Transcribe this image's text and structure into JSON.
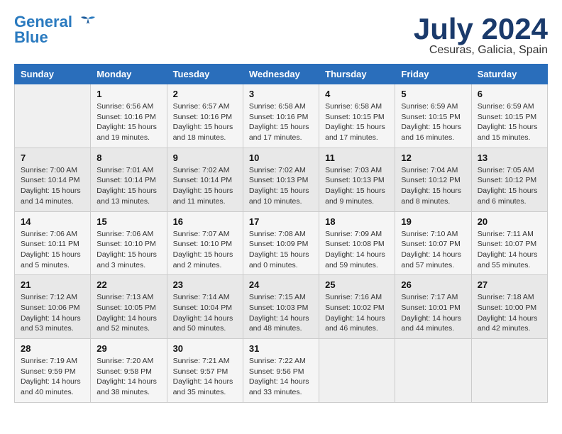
{
  "header": {
    "logo_line1": "General",
    "logo_line2": "Blue",
    "month": "July 2024",
    "location": "Cesuras, Galicia, Spain"
  },
  "weekdays": [
    "Sunday",
    "Monday",
    "Tuesday",
    "Wednesday",
    "Thursday",
    "Friday",
    "Saturday"
  ],
  "weeks": [
    [
      {
        "day": "",
        "sunrise": "",
        "sunset": "",
        "daylight": ""
      },
      {
        "day": "1",
        "sunrise": "Sunrise: 6:56 AM",
        "sunset": "Sunset: 10:16 PM",
        "daylight": "Daylight: 15 hours and 19 minutes."
      },
      {
        "day": "2",
        "sunrise": "Sunrise: 6:57 AM",
        "sunset": "Sunset: 10:16 PM",
        "daylight": "Daylight: 15 hours and 18 minutes."
      },
      {
        "day": "3",
        "sunrise": "Sunrise: 6:58 AM",
        "sunset": "Sunset: 10:16 PM",
        "daylight": "Daylight: 15 hours and 17 minutes."
      },
      {
        "day": "4",
        "sunrise": "Sunrise: 6:58 AM",
        "sunset": "Sunset: 10:15 PM",
        "daylight": "Daylight: 15 hours and 17 minutes."
      },
      {
        "day": "5",
        "sunrise": "Sunrise: 6:59 AM",
        "sunset": "Sunset: 10:15 PM",
        "daylight": "Daylight: 15 hours and 16 minutes."
      },
      {
        "day": "6",
        "sunrise": "Sunrise: 6:59 AM",
        "sunset": "Sunset: 10:15 PM",
        "daylight": "Daylight: 15 hours and 15 minutes."
      }
    ],
    [
      {
        "day": "7",
        "sunrise": "Sunrise: 7:00 AM",
        "sunset": "Sunset: 10:14 PM",
        "daylight": "Daylight: 15 hours and 14 minutes."
      },
      {
        "day": "8",
        "sunrise": "Sunrise: 7:01 AM",
        "sunset": "Sunset: 10:14 PM",
        "daylight": "Daylight: 15 hours and 13 minutes."
      },
      {
        "day": "9",
        "sunrise": "Sunrise: 7:02 AM",
        "sunset": "Sunset: 10:14 PM",
        "daylight": "Daylight: 15 hours and 11 minutes."
      },
      {
        "day": "10",
        "sunrise": "Sunrise: 7:02 AM",
        "sunset": "Sunset: 10:13 PM",
        "daylight": "Daylight: 15 hours and 10 minutes."
      },
      {
        "day": "11",
        "sunrise": "Sunrise: 7:03 AM",
        "sunset": "Sunset: 10:13 PM",
        "daylight": "Daylight: 15 hours and 9 minutes."
      },
      {
        "day": "12",
        "sunrise": "Sunrise: 7:04 AM",
        "sunset": "Sunset: 10:12 PM",
        "daylight": "Daylight: 15 hours and 8 minutes."
      },
      {
        "day": "13",
        "sunrise": "Sunrise: 7:05 AM",
        "sunset": "Sunset: 10:12 PM",
        "daylight": "Daylight: 15 hours and 6 minutes."
      }
    ],
    [
      {
        "day": "14",
        "sunrise": "Sunrise: 7:06 AM",
        "sunset": "Sunset: 10:11 PM",
        "daylight": "Daylight: 15 hours and 5 minutes."
      },
      {
        "day": "15",
        "sunrise": "Sunrise: 7:06 AM",
        "sunset": "Sunset: 10:10 PM",
        "daylight": "Daylight: 15 hours and 3 minutes."
      },
      {
        "day": "16",
        "sunrise": "Sunrise: 7:07 AM",
        "sunset": "Sunset: 10:10 PM",
        "daylight": "Daylight: 15 hours and 2 minutes."
      },
      {
        "day": "17",
        "sunrise": "Sunrise: 7:08 AM",
        "sunset": "Sunset: 10:09 PM",
        "daylight": "Daylight: 15 hours and 0 minutes."
      },
      {
        "day": "18",
        "sunrise": "Sunrise: 7:09 AM",
        "sunset": "Sunset: 10:08 PM",
        "daylight": "Daylight: 14 hours and 59 minutes."
      },
      {
        "day": "19",
        "sunrise": "Sunrise: 7:10 AM",
        "sunset": "Sunset: 10:07 PM",
        "daylight": "Daylight: 14 hours and 57 minutes."
      },
      {
        "day": "20",
        "sunrise": "Sunrise: 7:11 AM",
        "sunset": "Sunset: 10:07 PM",
        "daylight": "Daylight: 14 hours and 55 minutes."
      }
    ],
    [
      {
        "day": "21",
        "sunrise": "Sunrise: 7:12 AM",
        "sunset": "Sunset: 10:06 PM",
        "daylight": "Daylight: 14 hours and 53 minutes."
      },
      {
        "day": "22",
        "sunrise": "Sunrise: 7:13 AM",
        "sunset": "Sunset: 10:05 PM",
        "daylight": "Daylight: 14 hours and 52 minutes."
      },
      {
        "day": "23",
        "sunrise": "Sunrise: 7:14 AM",
        "sunset": "Sunset: 10:04 PM",
        "daylight": "Daylight: 14 hours and 50 minutes."
      },
      {
        "day": "24",
        "sunrise": "Sunrise: 7:15 AM",
        "sunset": "Sunset: 10:03 PM",
        "daylight": "Daylight: 14 hours and 48 minutes."
      },
      {
        "day": "25",
        "sunrise": "Sunrise: 7:16 AM",
        "sunset": "Sunset: 10:02 PM",
        "daylight": "Daylight: 14 hours and 46 minutes."
      },
      {
        "day": "26",
        "sunrise": "Sunrise: 7:17 AM",
        "sunset": "Sunset: 10:01 PM",
        "daylight": "Daylight: 14 hours and 44 minutes."
      },
      {
        "day": "27",
        "sunrise": "Sunrise: 7:18 AM",
        "sunset": "Sunset: 10:00 PM",
        "daylight": "Daylight: 14 hours and 42 minutes."
      }
    ],
    [
      {
        "day": "28",
        "sunrise": "Sunrise: 7:19 AM",
        "sunset": "Sunset: 9:59 PM",
        "daylight": "Daylight: 14 hours and 40 minutes."
      },
      {
        "day": "29",
        "sunrise": "Sunrise: 7:20 AM",
        "sunset": "Sunset: 9:58 PM",
        "daylight": "Daylight: 14 hours and 38 minutes."
      },
      {
        "day": "30",
        "sunrise": "Sunrise: 7:21 AM",
        "sunset": "Sunset: 9:57 PM",
        "daylight": "Daylight: 14 hours and 35 minutes."
      },
      {
        "day": "31",
        "sunrise": "Sunrise: 7:22 AM",
        "sunset": "Sunset: 9:56 PM",
        "daylight": "Daylight: 14 hours and 33 minutes."
      },
      {
        "day": "",
        "sunrise": "",
        "sunset": "",
        "daylight": ""
      },
      {
        "day": "",
        "sunrise": "",
        "sunset": "",
        "daylight": ""
      },
      {
        "day": "",
        "sunrise": "",
        "sunset": "",
        "daylight": ""
      }
    ]
  ]
}
